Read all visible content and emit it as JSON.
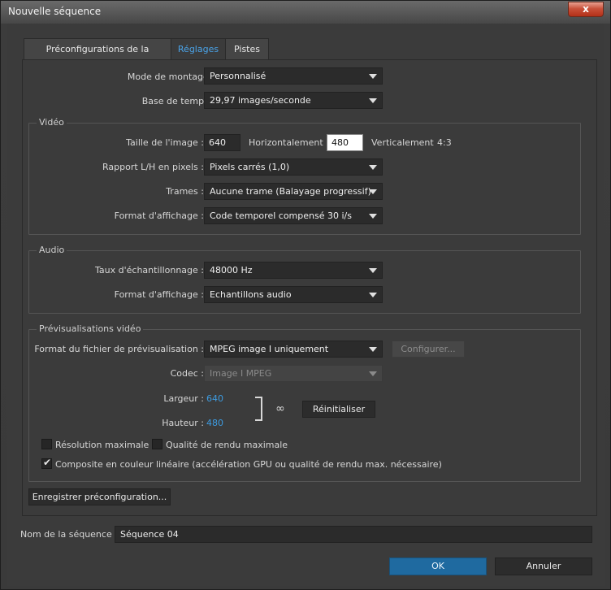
{
  "window": {
    "title": "Nouvelle séquence",
    "close_glyph": "x"
  },
  "tabs": [
    {
      "label": "Préconfigurations de la séquence",
      "active": false
    },
    {
      "label": "Réglages",
      "active": true
    },
    {
      "label": "Pistes",
      "active": false
    }
  ],
  "settings": {
    "editing_mode": {
      "label": "Mode de montage :",
      "value": "Personnalisé"
    },
    "timebase": {
      "label": "Base de temps :",
      "value": "29,97 images/seconde"
    }
  },
  "video": {
    "group_title": "Vidéo",
    "frame_size": {
      "label": "Taille de l'image :",
      "horizontal_value": "640",
      "horizontal_label": "Horizontalement",
      "vertical_value": "480",
      "vertical_label": "Verticalement",
      "aspect": "4:3"
    },
    "pixel_aspect": {
      "label": "Rapport L/H en pixels :",
      "value": "Pixels carrés (1,0)"
    },
    "fields": {
      "label": "Trames :",
      "value": "Aucune trame (Balayage progressif)"
    },
    "display_format": {
      "label": "Format d'affichage :",
      "value": "Code temporel compensé 30 i/s"
    }
  },
  "audio": {
    "group_title": "Audio",
    "sample_rate": {
      "label": "Taux d'échantillonnage :",
      "value": "48000 Hz"
    },
    "display_format": {
      "label": "Format d'affichage :",
      "value": "Echantillons audio"
    }
  },
  "previews": {
    "group_title": "Prévisualisations vidéo",
    "file_format": {
      "label": "Format du fichier de prévisualisation :",
      "value": "MPEG image I uniquement"
    },
    "configure_label": "Configurer...",
    "codec": {
      "label": "Codec :",
      "value": "Image I MPEG"
    },
    "width": {
      "label": "Largeur :",
      "value": "640"
    },
    "height": {
      "label": "Hauteur :",
      "value": "480"
    },
    "reset_label": "Réinitialiser",
    "max_resolution": {
      "label": "Résolution maximale",
      "checked": false
    },
    "max_render_quality": {
      "label": "Qualité de rendu maximale",
      "checked": false
    },
    "linear_color": {
      "label": "Composite en couleur linéaire (accélération GPU ou qualité de rendu max. nécessaire)",
      "checked": true
    }
  },
  "save_preset_label": "Enregistrer préconfiguration...",
  "sequence_name": {
    "label": "Nom de la séquence :",
    "value": "Séquence 04"
  },
  "buttons": {
    "ok": "OK",
    "cancel": "Annuler"
  },
  "icons": {
    "chain": "link-icon",
    "close": "close-icon",
    "check": "checkmark-icon",
    "dropdown": "chevron-down-icon"
  },
  "colors": {
    "accent": "#4aa3e8",
    "ok_button": "#1f6aa0",
    "close_button": "#c9513a",
    "background": "#3b3b3b"
  }
}
